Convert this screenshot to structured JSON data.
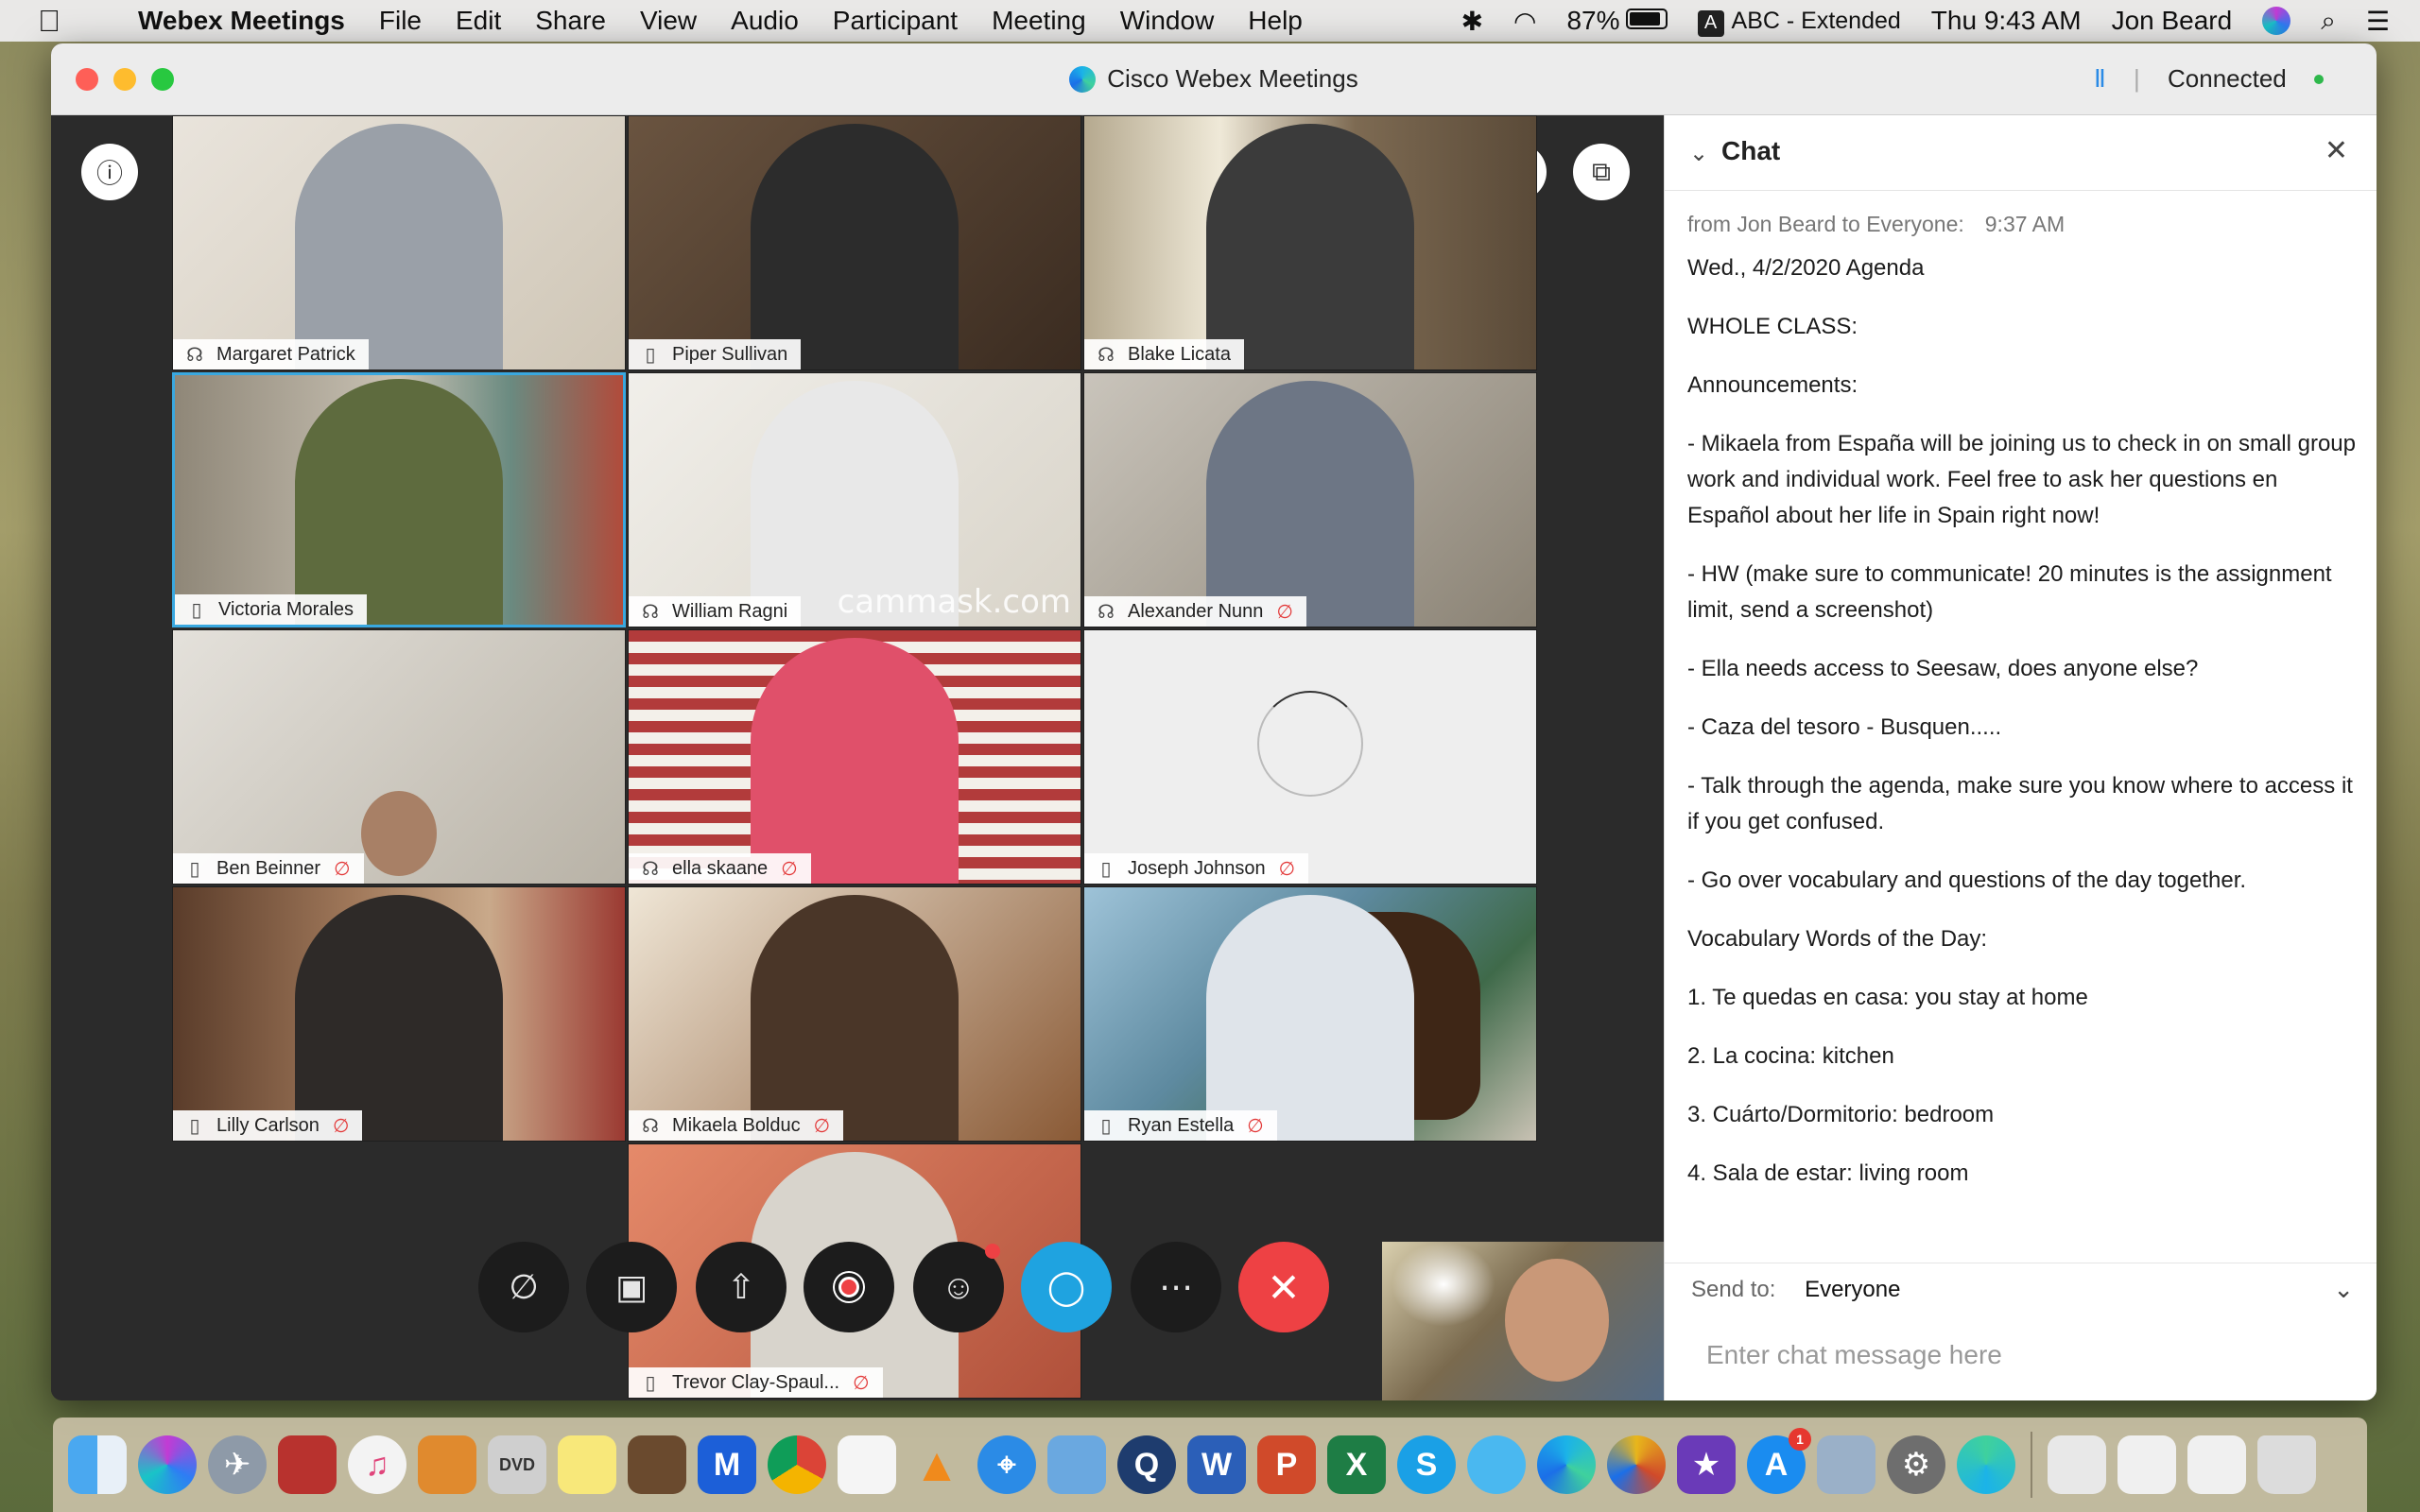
{
  "menubar": {
    "apple_icon": "apple-icon",
    "app_name": "Webex Meetings",
    "menus": [
      "File",
      "Edit",
      "Share",
      "View",
      "Audio",
      "Participant",
      "Meeting",
      "Window",
      "Help"
    ],
    "battery_percent": "87%",
    "input_source": "ABC - Extended",
    "input_badge": "A",
    "clock": "Thu 9:43 AM",
    "user": "Jon Beard"
  },
  "window": {
    "title": "Cisco Webex Meetings",
    "status": "Connected",
    "status_color": "#2eb84b"
  },
  "participants": [
    {
      "name": "Margaret Patrick",
      "device": "headset",
      "muted": false
    },
    {
      "name": "Piper Sullivan",
      "device": "phone",
      "muted": false
    },
    {
      "name": "Blake Licata",
      "device": "headset",
      "muted": false
    },
    {
      "name": "Victoria Morales",
      "device": "phone",
      "muted": false,
      "active": true
    },
    {
      "name": "William Ragni",
      "device": "headset",
      "muted": false,
      "watermark": "cammask.com"
    },
    {
      "name": "Alexander Nunn",
      "device": "headset",
      "muted": true
    },
    {
      "name": "Ben Beinner",
      "device": "phone",
      "muted": true
    },
    {
      "name": "ella skaane",
      "device": "headset",
      "muted": true
    },
    {
      "name": "Joseph Johnson",
      "device": "phone",
      "muted": true,
      "loading": true
    },
    {
      "name": "Lilly Carlson",
      "device": "phone",
      "muted": true
    },
    {
      "name": "Mikaela Bolduc",
      "device": "headset",
      "muted": true
    },
    {
      "name": "Ryan Estella",
      "device": "phone",
      "muted": true
    },
    {
      "name": "Trevor Clay-Spaul...",
      "device": "phone",
      "muted": true
    }
  ],
  "controls": [
    {
      "name": "mute",
      "icon": "microphone-muted-icon"
    },
    {
      "name": "video",
      "icon": "video-off-icon"
    },
    {
      "name": "share",
      "icon": "share-icon"
    },
    {
      "name": "record",
      "icon": "record-icon"
    },
    {
      "name": "participants",
      "icon": "participants-icon"
    },
    {
      "name": "chat",
      "icon": "chat-icon"
    },
    {
      "name": "more",
      "icon": "more-icon"
    },
    {
      "name": "end",
      "icon": "end-call-icon"
    }
  ],
  "chat": {
    "title": "Chat",
    "message": {
      "meta": "from Jon Beard to Everyone:",
      "time": "9:37  AM",
      "lines": [
        "Wed., 4/2/2020 Agenda",
        "WHOLE CLASS:",
        "Announcements:",
        "- Mikaela from España will be joining us to check in on small group work and individual work. Feel free to ask her questions en Español about her life in Spain right now!",
        "- HW (make sure to communicate! 20 minutes is the assignment limit, send a screenshot)",
        "- Ella needs access to Seesaw, does anyone else?",
        "- Caza del tesoro - Busquen.....",
        "- Talk through the agenda, make sure you know where to access it if you get confused.",
        "- Go over vocabulary and questions of the day together.",
        "Vocabulary Words of the Day:",
        "1. Te quedas en casa: you stay at home",
        "2. La cocina: kitchen",
        "3. Cuárto/Dormitorio: bedroom",
        "4. Sala de estar: living room"
      ]
    },
    "send_to_label": "Send to:",
    "send_to_value": "Everyone",
    "input_placeholder": "Enter chat message here"
  },
  "dock": {
    "apps": [
      "Finder",
      "Siri",
      "Launchpad",
      "Photo Booth",
      "iTunes",
      "Calculator",
      "DVD Player",
      "Notes",
      "Instruments",
      "Malwarebytes",
      "Chrome",
      "TextEdit",
      "VLC",
      "Safari",
      "Weather",
      "QuickTime",
      "Word",
      "PowerPoint",
      "Excel",
      "Skype",
      "Messages",
      "Webex",
      "Chrome Canary",
      "iMovie",
      "App Store",
      "Grapher",
      "System Preferences",
      "Webex Meetings",
      "Preview",
      "Documents",
      "Finder Windows",
      "Trash"
    ],
    "app_store_badge": "1"
  }
}
